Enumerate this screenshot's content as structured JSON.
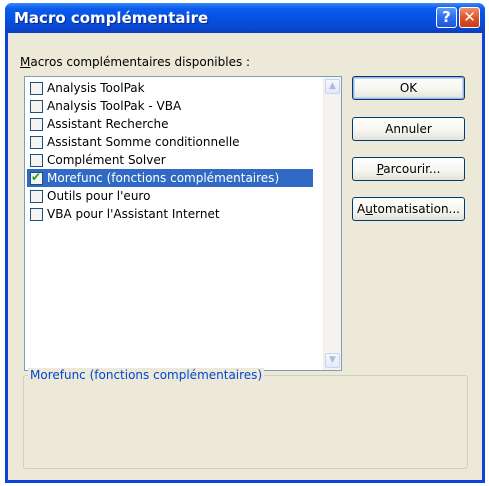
{
  "window": {
    "title": "Macro complémentaire",
    "help_glyph": "?",
    "close_glyph": "✕"
  },
  "list": {
    "caption_mnemonic": "M",
    "caption_rest": "acros complémentaires disponibles :",
    "items": [
      {
        "label": "Analysis ToolPak",
        "checked": false
      },
      {
        "label": "Analysis ToolPak - VBA",
        "checked": false
      },
      {
        "label": "Assistant Recherche",
        "checked": false
      },
      {
        "label": "Assistant Somme conditionnelle",
        "checked": false
      },
      {
        "label": "Complément Solver",
        "checked": false
      },
      {
        "label": "Morefunc (fonctions complémentaires)",
        "checked": true,
        "selected": true
      },
      {
        "label": "Outils pour l'euro",
        "checked": false
      },
      {
        "label": "VBA pour l'Assistant Internet",
        "checked": false
      }
    ],
    "check_glyph": "✔",
    "scroll_up_glyph": "▲",
    "scroll_down_glyph": "▼"
  },
  "buttons": {
    "ok": "OK",
    "cancel": "Annuler",
    "browse_mnemonic": "P",
    "browse_rest": "arcourir...",
    "automation_pre": "A",
    "automation_mnemonic": "u",
    "automation_rest": "tomatisation..."
  },
  "description": {
    "title": "Morefunc (fonctions complémentaires)"
  },
  "colors": {
    "titlebar": "#0450e0",
    "selection": "#316ac5",
    "dialog_bg": "#ece9d8",
    "group_title": "#0046d5"
  }
}
